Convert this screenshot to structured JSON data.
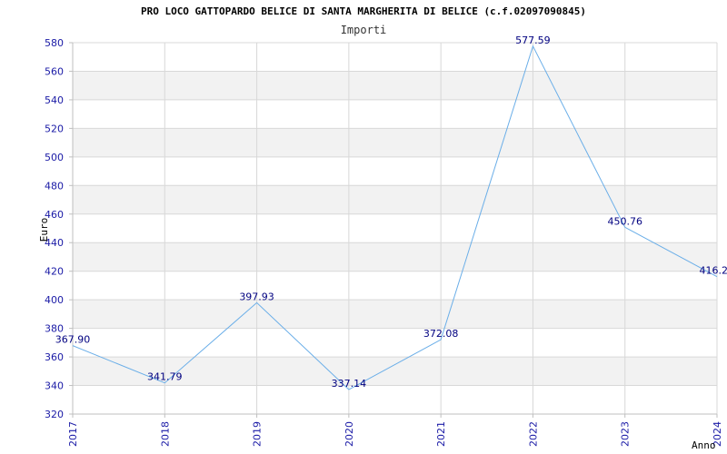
{
  "chart_data": {
    "type": "line",
    "title": "PRO LOCO GATTOPARDO BELICE DI SANTA MARGHERITA DI BELICE (c.f.02097090845)",
    "subtitle": "Importi",
    "ylabel": "Euro",
    "xlabel": "Anno",
    "x": [
      "2017",
      "2018",
      "2019",
      "2020",
      "2021",
      "2022",
      "2023",
      "2024"
    ],
    "series": [
      {
        "values": [
          367.9,
          341.79,
          397.93,
          337.14,
          372.08,
          577.59,
          450.76,
          416.2
        ],
        "labels": [
          "367.90",
          "341.79",
          "397.93",
          "337.14",
          "372.08",
          "577.59",
          "450.76",
          "416.2"
        ]
      }
    ],
    "ylim": [
      320,
      580
    ],
    "yticks": [
      "320",
      "340",
      "360",
      "380",
      "400",
      "420",
      "440",
      "460",
      "480",
      "500",
      "520",
      "540",
      "560",
      "580"
    ],
    "grid": true,
    "colors": {
      "line": "#6aaee8",
      "tick_label": "#1a1aa6",
      "data_label": "#000080",
      "band": "#f2f2f2",
      "gridline": "#d8d8d8",
      "axis": "#bfbfbf"
    }
  }
}
